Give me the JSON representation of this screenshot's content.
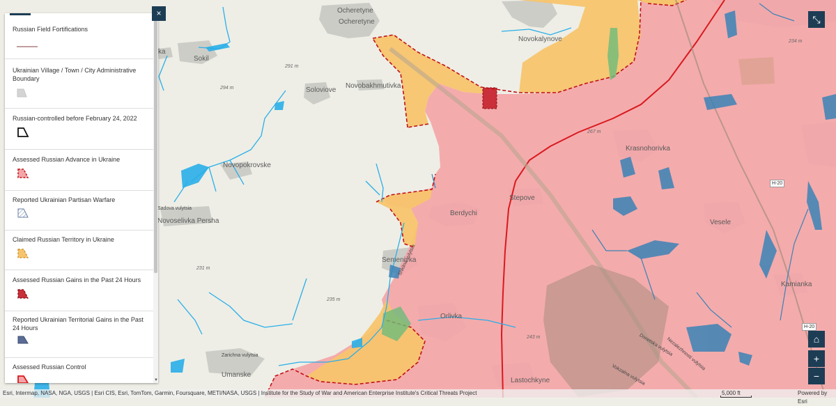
{
  "legend": {
    "items": [
      {
        "title": "Russian Field Fortifications",
        "symbol": "fortification-line"
      },
      {
        "title": "Ukrainian Village / Town / City Administrative Boundary",
        "symbol": "admin-boundary"
      },
      {
        "title": "Russian-controlled before February 24, 2022",
        "symbol": "pre-2022-outline"
      },
      {
        "title": "Assessed Russian Advance in Ukraine",
        "symbol": "advance-dashed"
      },
      {
        "title": "Reported Ukrainian Partisan Warfare",
        "symbol": "partisan-hatch"
      },
      {
        "title": "Claimed Russian Territory in Ukraine",
        "symbol": "claimed-orange"
      },
      {
        "title": "Assessed Russian Gains in the Past 24 Hours",
        "symbol": "gains-24h"
      },
      {
        "title": "Reported Ukrainian Territorial Gains in the Past 24 Hours",
        "symbol": "ukr-gains-24h"
      },
      {
        "title": "Assessed Russian Control",
        "symbol": "russian-control"
      }
    ],
    "close_label": "×"
  },
  "colors": {
    "russian_control": "#f4a5a7",
    "claimed": "#f7c46e",
    "border_red": "#d9191e",
    "water": "#29aee8",
    "navy": "#1d3d55",
    "settlement": "#c9c9c4"
  },
  "places": [
    {
      "id": "ocheretyne-1",
      "label": "Ocheretyne"
    },
    {
      "id": "ocheretyne-2",
      "label": "Ocheretyne"
    },
    {
      "id": "novokalynove",
      "label": "Novokalynove"
    },
    {
      "id": "sokil",
      "label": "Sokil"
    },
    {
      "id": "soloviove",
      "label": "Soloviove"
    },
    {
      "id": "novobakhmutivka",
      "label": "Novobakhmutivka"
    },
    {
      "id": "novopokrovske",
      "label": "Novopokrovske"
    },
    {
      "id": "krasnohorivka",
      "label": "Krasnohorivka"
    },
    {
      "id": "berdychi",
      "label": "Berdychi"
    },
    {
      "id": "stepove",
      "label": "Stepove"
    },
    {
      "id": "vesele",
      "label": "Vesele"
    },
    {
      "id": "novoselivka-persha",
      "label": "Novoselivka Persha"
    },
    {
      "id": "semenivka",
      "label": "Semenivka"
    },
    {
      "id": "orlivka",
      "label": "Orlivka"
    },
    {
      "id": "kamianka",
      "label": "Kamianka"
    },
    {
      "id": "umanske",
      "label": "Umanske"
    },
    {
      "id": "lastochkyne",
      "label": "Lastochkyne"
    },
    {
      "id": "ka",
      "label": "ka"
    }
  ],
  "elevations": [
    "291 m",
    "294 m",
    "267 m",
    "234 m",
    "231 m",
    "235 m",
    "243 m"
  ],
  "roads": [
    "Sadova vulytsia",
    "Zarichna vulytsia",
    "Donetska vulytsia",
    "Shkilna vulytsia",
    "Nezalezhnosti vulytsia",
    "Vokzalna vulytsia"
  ],
  "highway_shields": [
    "H-20",
    "H-20"
  ],
  "attribution": "Esri, Intermap, NASA, NGA, USGS | Esri CIS, Esri, TomTom, Garmin, Foursquare, METI/NASA, USGS | Institute for the Study of War and American Enterprise Institute's Critical Threats Project",
  "scale_label": "5,000 ft",
  "powered_by": "Powered by Esri",
  "controls": {
    "home": "⌂",
    "zoom_in": "+",
    "zoom_out": "−",
    "fullscreen": "⤡"
  }
}
